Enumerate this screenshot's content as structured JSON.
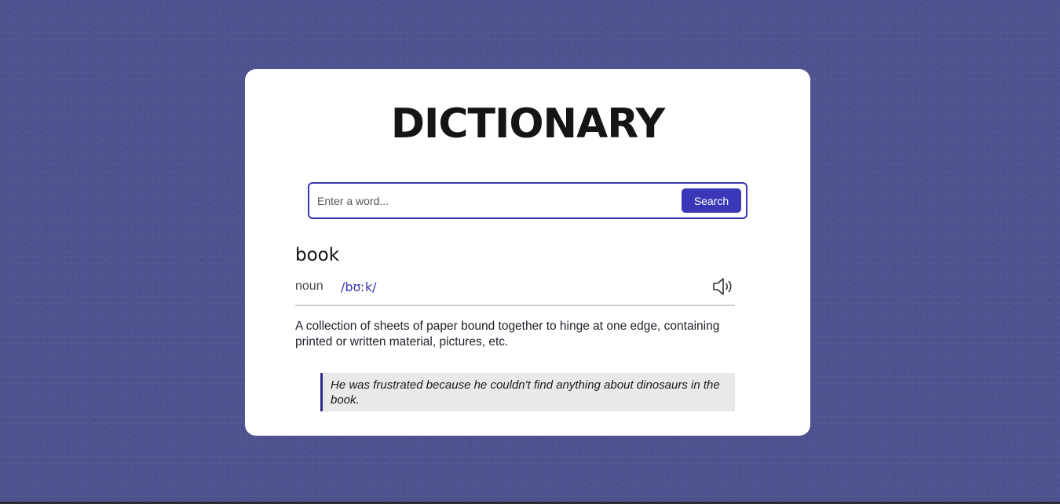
{
  "app": {
    "title": "DICTIONARY"
  },
  "search": {
    "placeholder": "Enter a word...",
    "value": "",
    "button_label": "Search"
  },
  "result": {
    "word": "book",
    "part_of_speech": "noun",
    "phonetic": "/bʊːk/",
    "audio_icon": "speaker-icon",
    "definition": "A collection of sheets of paper bound together to hinge at one edge, containing printed or written material, pictures, etc.",
    "example": "He was frustrated because he couldn't find anything about dinosaurs in the book."
  },
  "colors": {
    "accent": "#3a37b8",
    "background": "#4d5190",
    "card": "#ffffff",
    "example_background": "#e9e9e9"
  }
}
